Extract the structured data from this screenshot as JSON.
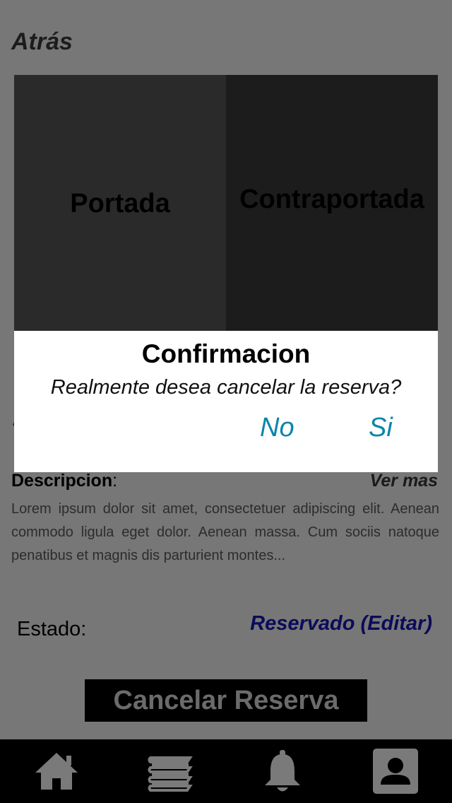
{
  "header": {
    "back_label": "Atrás"
  },
  "covers": {
    "front_label": "Portada",
    "back_label": "Contraportada"
  },
  "description": {
    "label": "Descripcion",
    "colon": ":",
    "see_more": "Ver mas",
    "text": "Lorem ipsum dolor sit amet, consectetuer adipiscing elit. Aenean commodo ligula eget dolor. Aenean massa. Cum sociis natoque penatibus et magnis dis parturient montes..."
  },
  "status": {
    "label": "Estado:",
    "value": "Reservado (Editar)"
  },
  "cancel_button": {
    "label": "Cancelar Reserva"
  },
  "dialog": {
    "title": "Confirmacion",
    "message": "Realmente desea cancelar la reserva?",
    "no_label": "No",
    "yes_label": "Si"
  },
  "nav": {
    "items": [
      {
        "icon": "home-icon"
      },
      {
        "icon": "books-icon"
      },
      {
        "icon": "bell-icon"
      },
      {
        "icon": "profile-icon"
      }
    ]
  },
  "colors": {
    "overlay_background": "#777777",
    "dialog_button": "#0a86a8",
    "status_value": "#0b0b5a",
    "nav_background": "#000000",
    "nav_icon": "#7a7a7a"
  }
}
